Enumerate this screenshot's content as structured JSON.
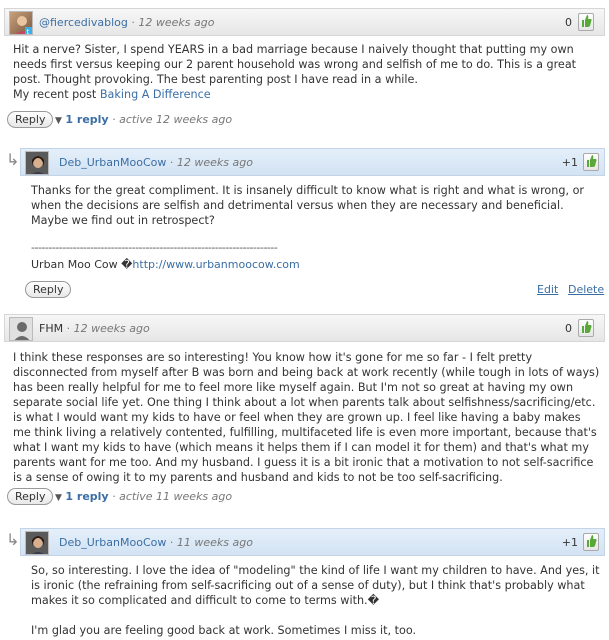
{
  "comments": [
    {
      "author": "@fiercedivablog",
      "time": "12 weeks ago",
      "votes": "0",
      "text": "Hit a nerve? Sister, I spend YEARS in a bad marriage because I naively thought that putting my own needs first versus keeping our 2 parent household was wrong and selfish of me to do. This is a great post. Thought provoking. The best parenting post I have read in a while.",
      "recent_post_prefix": "My recent post",
      "recent_post_link": "Baking A Difference",
      "reply_label": "Reply",
      "replies_count": "1 reply",
      "active_text": "active 12 weeks ago"
    },
    {
      "author": "Deb_UrbanMooCow",
      "time": "12 weeks ago",
      "votes": "+1",
      "text": "Thanks for the great compliment. It is insanely difficult to know what is right and what is wrong, or when the decisions are selfish and detrimental versus when they are necessary and beneficial. Maybe we find out in retrospect?",
      "signature_line": "-----------------------------------------------------------------------",
      "signature_name": "Urban Moo Cow �",
      "signature_url": "http://www.urbanmoocow.com",
      "reply_label": "Reply",
      "edit_label": "Edit",
      "delete_label": "Delete"
    },
    {
      "author": "FHM",
      "time": "12 weeks ago",
      "votes": "0",
      "text": "I think these responses are so interesting! You know how it's gone for me so far - I felt pretty disconnected from myself after B was born and being back at work recently (while tough in lots of ways) has been really helpful for me to feel more like myself again. But I'm not so great at having my own separate social life yet. One thing I think about a lot when parents talk about selfishness/sacrificing/etc. is what I would want my kids to have or feel when they are grown up. I feel like having a baby makes me think living a relatively contented, fulfilling, multifaceted life is even more important, because that's what I want my kids to have (which means it helps them if I can model it for them) and that's what my parents want for me too. And my husband. I guess it is a bit ironic that a motivation to not self-sacrifice is a sense of owing it to my parents and husband and kids to not be too self-sacrificing.",
      "reply_label": "Reply",
      "replies_count": "1 reply",
      "active_text": "active 11 weeks ago"
    },
    {
      "author": "Deb_UrbanMooCow",
      "time": "11 weeks ago",
      "votes": "+1",
      "text": "So, so interesting. I love the idea of \"modeling\" the kind of life I want my children to have. And yes, it is ironic (the refraining from self-sacrificing out of a sense of duty), but I think that's probably what makes it so complicated and difficult to come to terms with.�",
      "text2": "I'm glad you are feeling good back at work. Sometimes I miss it, too."
    }
  ],
  "icons": {
    "reply_arrow": "↳",
    "thumb": "👍",
    "triangle": "▼"
  },
  "colors": {
    "link": "#3a6ea5",
    "header_bg": "#ececec",
    "reply_header_bg": "#dbe8f6"
  }
}
